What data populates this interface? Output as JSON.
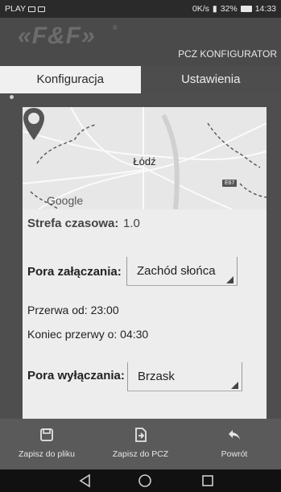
{
  "status_bar": {
    "carrier": "PLAY",
    "speed": "0K/s",
    "battery": "32%",
    "time": "14:33"
  },
  "header": {
    "logo_text": "«F&F»",
    "logo_mark": "®",
    "app_title": "PCZ KONFIGURATOR"
  },
  "tabs": [
    {
      "label": "Konfiguracja",
      "active": true
    },
    {
      "label": "Ustawienia",
      "active": false
    }
  ],
  "map": {
    "city": "Łódź",
    "provider": "Google",
    "road_badge": "E67"
  },
  "form": {
    "timezone_label": "Strefa czasowa:",
    "timezone_value": "1.0",
    "on_time_label": "Pora załączania:",
    "on_time_value": "Zachód słońca",
    "break_from": "Przerwa od: 23:00",
    "break_end": "Koniec przerwy o: 04:30",
    "off_time_label": "Pora wyłączania:",
    "off_time_value": "Brzask"
  },
  "actions": [
    {
      "label": "Zapisz do pliku",
      "icon": "save-icon"
    },
    {
      "label": "Zapisz do PCZ",
      "icon": "export-icon"
    },
    {
      "label": "Powrót",
      "icon": "reply-icon"
    }
  ],
  "nav_bar": {
    "back": "back-triangle-icon",
    "home": "home-circle-icon",
    "recents": "recents-square-icon"
  }
}
